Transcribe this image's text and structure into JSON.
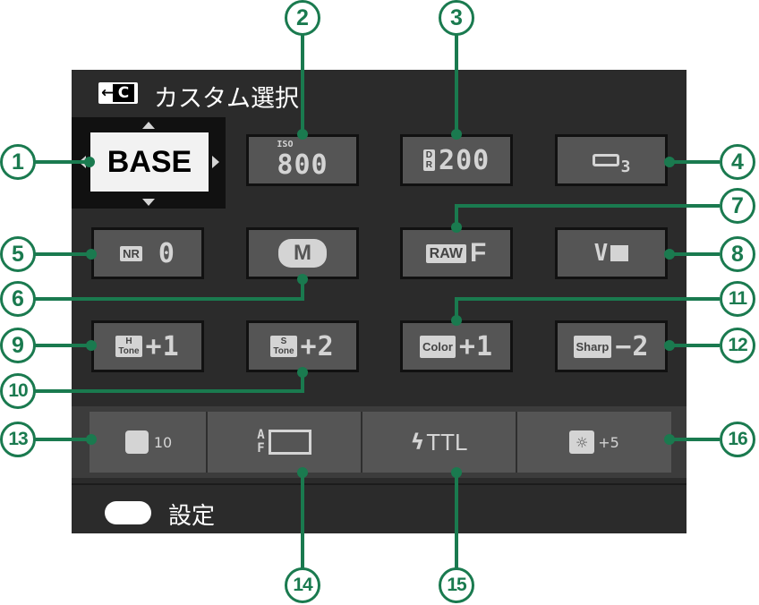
{
  "header": {
    "title": "カスタム選択",
    "icon_arrow": "←",
    "icon_letter": "C"
  },
  "selected": {
    "label": "BASE"
  },
  "tiles": {
    "iso": {
      "chip": "ISO",
      "value": "800"
    },
    "dr": {
      "chip_top": "D",
      "chip_bot": "R",
      "value": "200"
    },
    "highlight": {
      "value": "3"
    },
    "nr": {
      "chip": "NR",
      "value": "0"
    },
    "mode": {
      "value": "M"
    },
    "raw": {
      "chip": "RAW",
      "value": "F"
    },
    "film": {
      "chip": "V"
    },
    "htone": {
      "chip_top": "H",
      "chip_bot": "Tone",
      "value": "+1"
    },
    "stone": {
      "chip_top": "S",
      "chip_bot": "Tone",
      "value": "+2"
    },
    "color": {
      "chip": "Color",
      "value": "+1"
    },
    "sharp": {
      "chip": "Sharp",
      "value": "−2"
    }
  },
  "bottom": {
    "timer": {
      "value": "10"
    },
    "af": {
      "prefix_top": "A",
      "prefix_bot": "F"
    },
    "flash": {
      "value": "TTL"
    },
    "brightness": {
      "value": "+5"
    }
  },
  "footer": {
    "label": "設定"
  },
  "callouts": [
    "1",
    "2",
    "3",
    "4",
    "5",
    "6",
    "7",
    "8",
    "9",
    "10",
    "11",
    "12",
    "13",
    "14",
    "15",
    "16"
  ],
  "colors": {
    "accent": "#1a7a4f",
    "screen": "#2b2b2b",
    "tile": "#555555"
  }
}
